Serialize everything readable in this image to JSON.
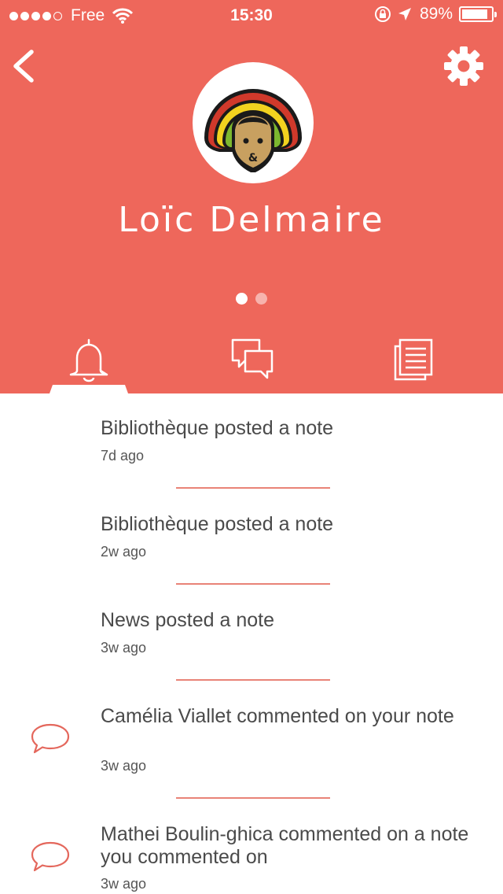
{
  "status_bar": {
    "carrier": "Free",
    "time": "15:30",
    "battery_text": "89%",
    "battery_level": 0.89,
    "signal_bars_filled": 4,
    "signal_bars_total": 5
  },
  "header": {
    "profile_name": "Loïc Delmaire",
    "back_icon": "chevron-left-icon",
    "settings_icon": "gear-icon",
    "page_indicator": {
      "count": 2,
      "active_index": 0
    },
    "tabs": [
      {
        "id": "notifications",
        "icon": "bell-icon",
        "active": true
      },
      {
        "id": "messages",
        "icon": "chat-bubbles-icon",
        "active": false
      },
      {
        "id": "notes",
        "icon": "notes-list-icon",
        "active": false
      }
    ]
  },
  "notifications": [
    {
      "title": "Bibliothèque posted a note",
      "time": "7d ago",
      "icon": ""
    },
    {
      "title": "Bibliothèque posted a note",
      "time": "2w ago",
      "icon": ""
    },
    {
      "title": "News posted a note",
      "time": "3w ago",
      "icon": ""
    },
    {
      "title": "Camélia Viallet commented on your note",
      "time": "3w ago",
      "icon": "comment-icon"
    },
    {
      "title": "Mathei Boulin-ghica commented on a note you commented on",
      "time": "3w ago",
      "icon": "comment-icon"
    }
  ],
  "colors": {
    "accent": "#ee675b",
    "separator": "#e98377",
    "text": "#4a4a4a",
    "background": "#ffffff"
  }
}
